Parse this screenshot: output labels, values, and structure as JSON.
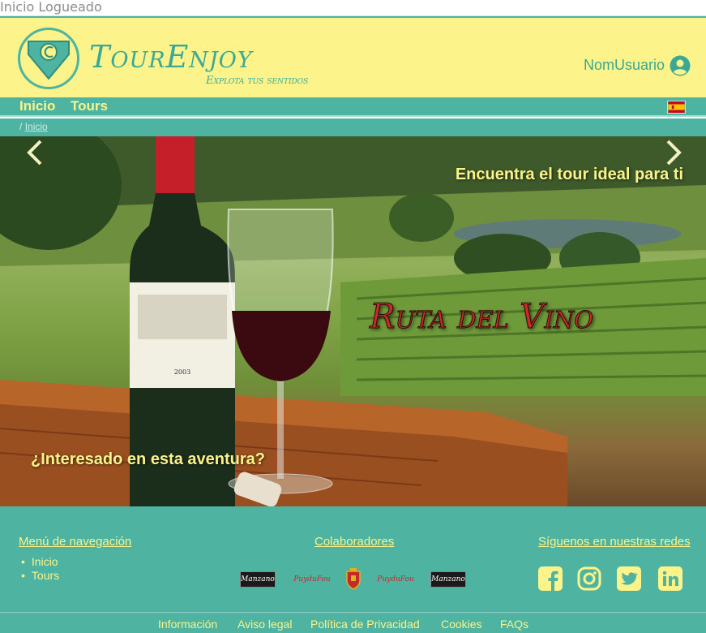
{
  "window": {
    "title": "Inicio Logueado"
  },
  "header": {
    "brand_name": "TourEnjoy",
    "brand_tagline": "Explota tus sentidos",
    "username": "NomUsuario",
    "user_icon": "user-circle-icon"
  },
  "nav": {
    "items": [
      {
        "label": "Inicio"
      },
      {
        "label": "Tours"
      }
    ],
    "language_flag": "spain-flag-icon"
  },
  "breadcrumb": {
    "separator": "/",
    "current": "Inicio"
  },
  "hero": {
    "tagline_top": "Encuentra el tour ideal para ti",
    "title": "Ruta del Vino",
    "tagline_bottom": "¿Interesado en esta aventura?",
    "prev_icon": "chevron-left-icon",
    "next_icon": "chevron-right-icon"
  },
  "footer": {
    "nav_heading": "Menú de navegación",
    "nav_items": [
      {
        "label": "Inicio"
      },
      {
        "label": "Tours"
      }
    ],
    "partners_heading": "Colaboradores",
    "partners": [
      {
        "label": "Manzano"
      },
      {
        "label": "PuyduFou"
      },
      {
        "label": "crest-emblem"
      },
      {
        "label": "PuyduFou"
      },
      {
        "label": "Manzano"
      }
    ],
    "social_heading": "Síguenos en nuestras redes",
    "social": [
      {
        "icon": "facebook-icon"
      },
      {
        "icon": "instagram-icon"
      },
      {
        "icon": "twitter-icon"
      },
      {
        "icon": "linkedin-icon"
      }
    ],
    "legal_links": [
      {
        "label": "Información"
      },
      {
        "label": "Aviso legal"
      },
      {
        "label": "Política de Privacidad"
      },
      {
        "label": "Cookies"
      },
      {
        "label": "FAQs"
      }
    ]
  },
  "colors": {
    "primary": "#4eb3a1",
    "accent": "#fcf48a",
    "hero_title": "#c92a2a"
  }
}
